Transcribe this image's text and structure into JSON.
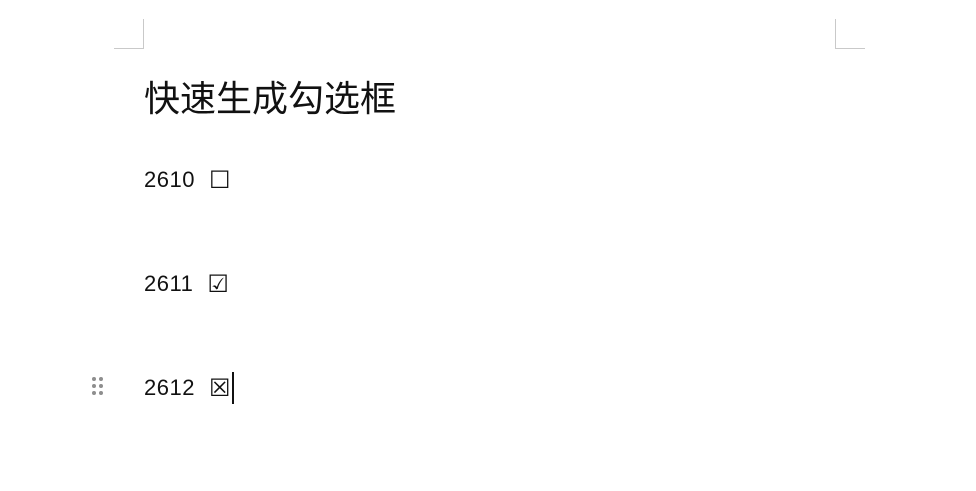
{
  "document": {
    "title": "快速生成勾选框",
    "lines": [
      {
        "code": "2610",
        "symbol": "☐"
      },
      {
        "code": "2611",
        "symbol": "☑"
      },
      {
        "code": "2612",
        "symbol": "☒"
      }
    ]
  },
  "icons": {
    "drag_handle": "drag-handle-icon",
    "cursor": "text-cursor-icon"
  },
  "colors": {
    "text": "#111111",
    "background": "#ffffff",
    "crop_marks": "#c9c9c9",
    "handle": "#8e8e8e"
  }
}
